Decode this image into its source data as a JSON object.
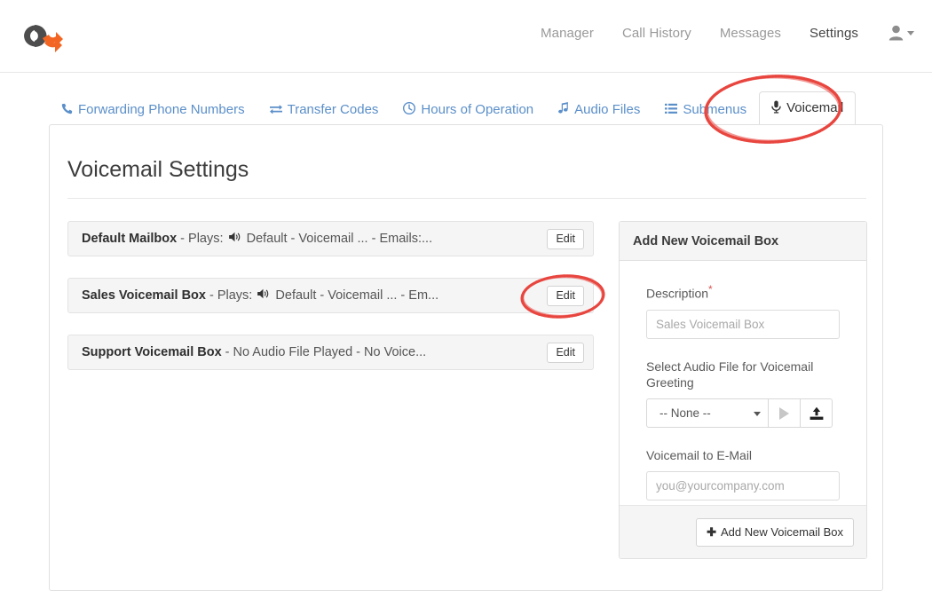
{
  "header": {
    "logo_name": "company-logo",
    "nav": [
      {
        "label": "Manager",
        "active": false
      },
      {
        "label": "Call History",
        "active": false
      },
      {
        "label": "Messages",
        "active": false
      },
      {
        "label": "Settings",
        "active": true
      }
    ],
    "user_menu": {
      "icon": "user-icon",
      "caret": "chevron-down-icon"
    }
  },
  "tabs": [
    {
      "label": "Forwarding Phone Numbers",
      "icon": "phone-icon",
      "glyph": "✆",
      "active": false
    },
    {
      "label": "Transfer Codes",
      "icon": "exchange-icon",
      "glyph": "⇄",
      "active": false
    },
    {
      "label": "Hours of Operation",
      "icon": "clock-icon",
      "glyph": "◴",
      "active": false
    },
    {
      "label": "Audio Files",
      "icon": "music-note-icon",
      "glyph": "♫",
      "active": false
    },
    {
      "label": "Submenus",
      "icon": "list-icon",
      "glyph": "☰",
      "active": false
    },
    {
      "label": "Voicemail",
      "icon": "microphone-icon",
      "glyph": "Ἲ4",
      "active": true
    }
  ],
  "main": {
    "title": "Voicemail Settings",
    "rows": [
      {
        "name": "Default Mailbox",
        "detail_before": " - Plays: ",
        "speaker_icon": "speaker-icon",
        "detail_after": " Default - Voicemail ... - Emails:...",
        "edit_label": "Edit"
      },
      {
        "name": "Sales Voicemail Box",
        "detail_before": " - Plays: ",
        "speaker_icon": "speaker-icon",
        "detail_after": " Default - Voicemail ... - Em...",
        "edit_label": "Edit"
      },
      {
        "name": "Support Voicemail Box",
        "detail_before": " - No Audio File Played - No Voice...",
        "speaker_icon": "",
        "detail_after": "",
        "edit_label": "Edit"
      }
    ]
  },
  "panel": {
    "heading": "Add New Voicemail Box",
    "description_label": "Description",
    "description_required": "*",
    "description_placeholder": "Sales Voicemail Box",
    "description_value": "",
    "audio_label": "Select Audio File for Voicemail Greeting",
    "audio_selected": "-- None --",
    "audio_options": [
      "-- None --"
    ],
    "play_icon": "play-icon",
    "upload_icon": "upload-icon",
    "email_label": "Voicemail to E-Mail",
    "email_placeholder": "you@yourcompany.com",
    "email_value": "",
    "add_button_label": "Add New Voicemail Box",
    "add_button_icon": "plus-icon"
  },
  "annotations": {
    "color": "#e8463f",
    "items": [
      {
        "name": "annotation-ellipse-voicemail-tab",
        "shape": "ellipse"
      },
      {
        "name": "annotation-ellipse-sales-edit-button",
        "shape": "ellipse"
      }
    ]
  },
  "colors": {
    "link_blue": "#5b8fc9",
    "logo_orange": "#f26522",
    "logo_dark": "#4d4d4d",
    "annotation_red": "#e8463f",
    "row_bg": "#f5f5f5"
  }
}
